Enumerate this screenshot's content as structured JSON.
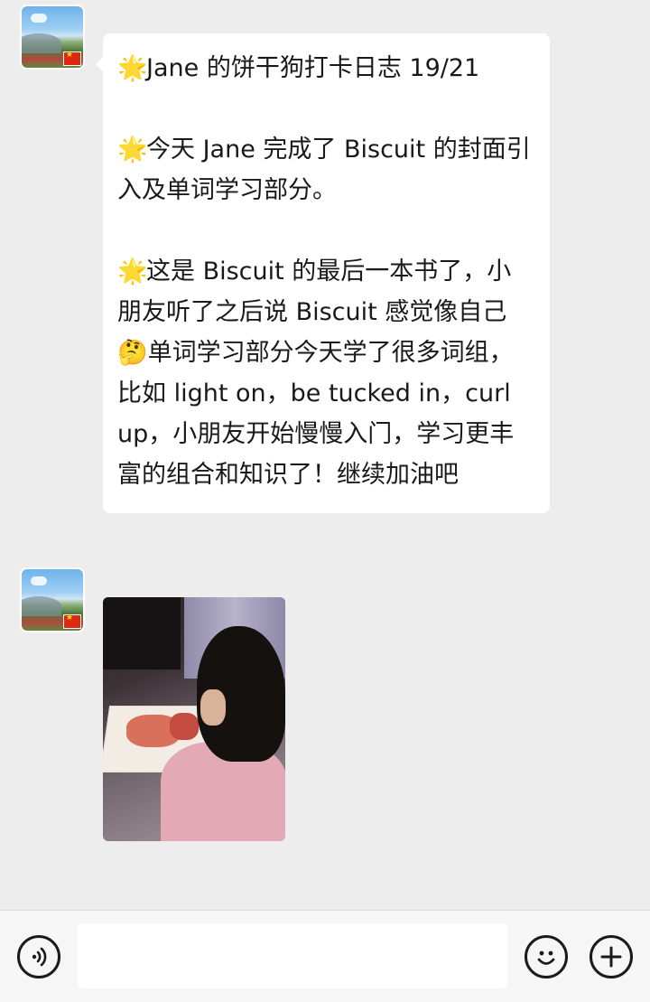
{
  "messages": [
    {
      "type": "text",
      "paragraphs": [
        {
          "icon": "🌟",
          "text": "Jane 的饼干狗打卡日志 19/21"
        },
        {
          "icon": "🌟",
          "text": "今天 Jane 完成了 Biscuit 的封面引入及单词学习部分。"
        },
        {
          "icon": "🌟",
          "text_before_emoji": "这是 Biscuit 的最后一本书了，小朋友听了之后说 Biscuit 感觉像自己",
          "emoji": "🤔",
          "text_after_emoji": "单词学习部分今天学了很多词组，比如 light on，be tucked in，curl up，小朋友开始慢慢入门，学习更丰富的组合和知识了！继续加油吧"
        }
      ]
    },
    {
      "type": "image"
    }
  ],
  "input_bar": {
    "placeholder": "",
    "voice_icon": "voice-icon",
    "emoji_icon": "emoji-icon",
    "plus_icon": "plus-icon"
  },
  "colors": {
    "background": "#ededed",
    "bubble": "#ffffff",
    "star": "#f3c623"
  }
}
